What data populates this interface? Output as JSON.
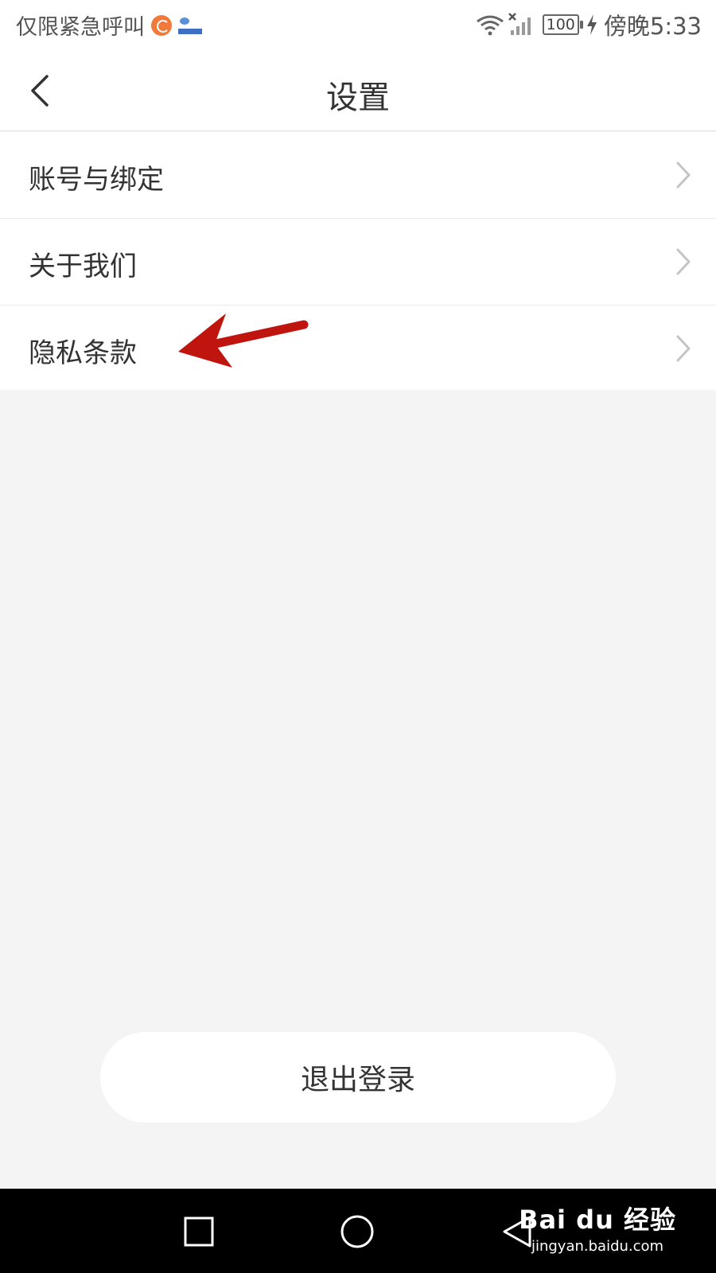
{
  "status_bar": {
    "carrier_text": "仅限紧急呼叫",
    "battery": "100",
    "time": "傍晚5:33"
  },
  "nav": {
    "title": "设置"
  },
  "settings": {
    "items": [
      {
        "label": "账号与绑定"
      },
      {
        "label": "关于我们"
      },
      {
        "label": "隐私条款"
      }
    ]
  },
  "logout": {
    "label": "退出登录"
  },
  "watermark": {
    "logo": "Bai du 经验",
    "url": "jingyan.baidu.com"
  },
  "colors": {
    "background": "#f4f4f4",
    "surface": "#ffffff",
    "text": "#333333",
    "annotation_arrow": "#c0140f"
  }
}
